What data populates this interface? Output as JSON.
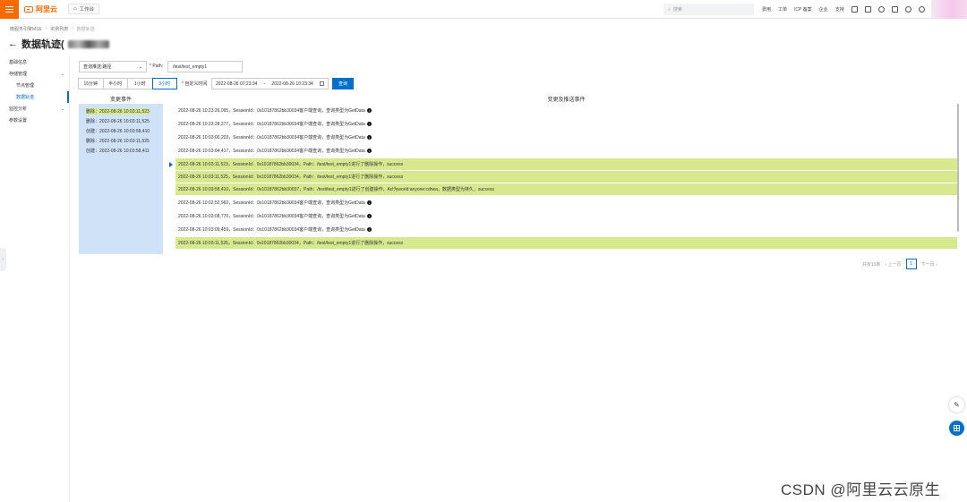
{
  "topbar": {
    "logo_text": "阿里云",
    "workbench_label": "工作台",
    "search_placeholder": "搜索",
    "nav_links": [
      "费用",
      "工单",
      "ICP 备案",
      "企业",
      "支持"
    ],
    "brand_color": "#ff6a00"
  },
  "breadcrumb": [
    "微服务引擎MSE",
    "实例列表",
    "数据轨迹"
  ],
  "page_title": "数据轨迹(",
  "sidebar": {
    "items": [
      {
        "label": "基础信息",
        "indent": false,
        "chevron": ""
      },
      {
        "label": "存储管理",
        "indent": false,
        "chevron": "⌄"
      },
      {
        "label": "节点管理",
        "indent": true,
        "chevron": ""
      },
      {
        "label": "数据轨迹",
        "indent": true,
        "chevron": "",
        "active": true
      },
      {
        "label": "监控分析",
        "indent": false,
        "chevron": "⌄"
      },
      {
        "label": "参数设置",
        "indent": false,
        "chevron": ""
      }
    ]
  },
  "controls": {
    "query_type": "查询推送:路径",
    "path_label": "Path:",
    "path_value": "/test/test_empty1",
    "time_ranges": [
      "15分钟",
      "半小时",
      "1小时",
      "3小时"
    ],
    "active_range": "3小时",
    "custom_time_label": "自定义时间",
    "start_time": "2022-08-26 07:23:34",
    "range_sep": "-",
    "end_time": "2022-08-26 10:23:34",
    "query_button": "查询",
    "accent_color": "#0070cc"
  },
  "change_events": {
    "header": "变更事件",
    "items": [
      {
        "text": "删除：2022-08-26 10:03:11,523",
        "highlight": true
      },
      {
        "text": "删除：2022-08-26 10:03:11,525",
        "highlight": false
      },
      {
        "text": "创建：2022-08-26 10:03:58,410",
        "highlight": false
      },
      {
        "text": "删除：2022-08-26 10:03:11,525",
        "highlight": false
      },
      {
        "text": "创建：2022-08-26 10:03:58,411",
        "highlight": false
      }
    ]
  },
  "push_events": {
    "header": "变更及推送事件",
    "rows": [
      {
        "text": "2022-08-26 10:23:26,095，SessionId：0x10187862bb30034客户端查询，查询类型为GetData",
        "info": true,
        "highlight": false
      },
      {
        "text": "2022-08-26 10:23:28,277，SessionId：0x10187862bb30034客户端查询，查询类型为GetData",
        "info": true,
        "highlight": false
      },
      {
        "text": "2022-08-26 10:03:00,203，SessionId：0x10187862bb30034客户端查询，查询类型为GetData",
        "info": true,
        "highlight": false
      },
      {
        "text": "2022-08-26 10:03:04,417，SessionId：0x10187862bb30034客户端查询，查询类型为GetData",
        "info": true,
        "highlight": false
      },
      {
        "text": "2022-08-26 10:03:11,523，SessionId：0x10187862bb30034，Path：/test/test_empty1进行了删除操作，success",
        "info": false,
        "highlight": true
      },
      {
        "text": "2022-08-26 10:03:11,525，SessionId：0x10187862bb30034，Path：/test/test_empty1进行了删除操作，success",
        "info": false,
        "highlight": true
      },
      {
        "text": "2022-08-26 10:03:58,410，SessionId：0x10187862bb30037，Path：/test/test_empty1进行了创建操作，Acl为world:anyone:cdrwa，数据类型为持久，success",
        "info": false,
        "highlight": true
      },
      {
        "text": "2022-08-26 10:02:52,962，SessionId：0x10187862bb30034客户端查询，查询类型为GetData",
        "info": true,
        "highlight": false
      },
      {
        "text": "2022-08-26 10:03:08,770，SessionId：0x10187862bb30034客户端查询，查询类型为GetData",
        "info": true,
        "highlight": false
      },
      {
        "text": "2022-08-26 10:03:09,459，SessionId：0x10187862bb30034客户端查询，查询类型为GetData",
        "info": true,
        "highlight": false
      },
      {
        "text": "2022-08-26 10:03:11,525，SessionId：0x10187862bb30034，Path：/test/test_empty1进行了删除操作，success",
        "info": false,
        "highlight": true
      }
    ],
    "highlight_color": "#d6e98f",
    "panel_color": "#cfe2f8"
  },
  "pagination": {
    "total": "共有13条",
    "prev": "上一页",
    "current": "1",
    "next": "下一页"
  },
  "watermark": "CSDN @阿里云云原生"
}
